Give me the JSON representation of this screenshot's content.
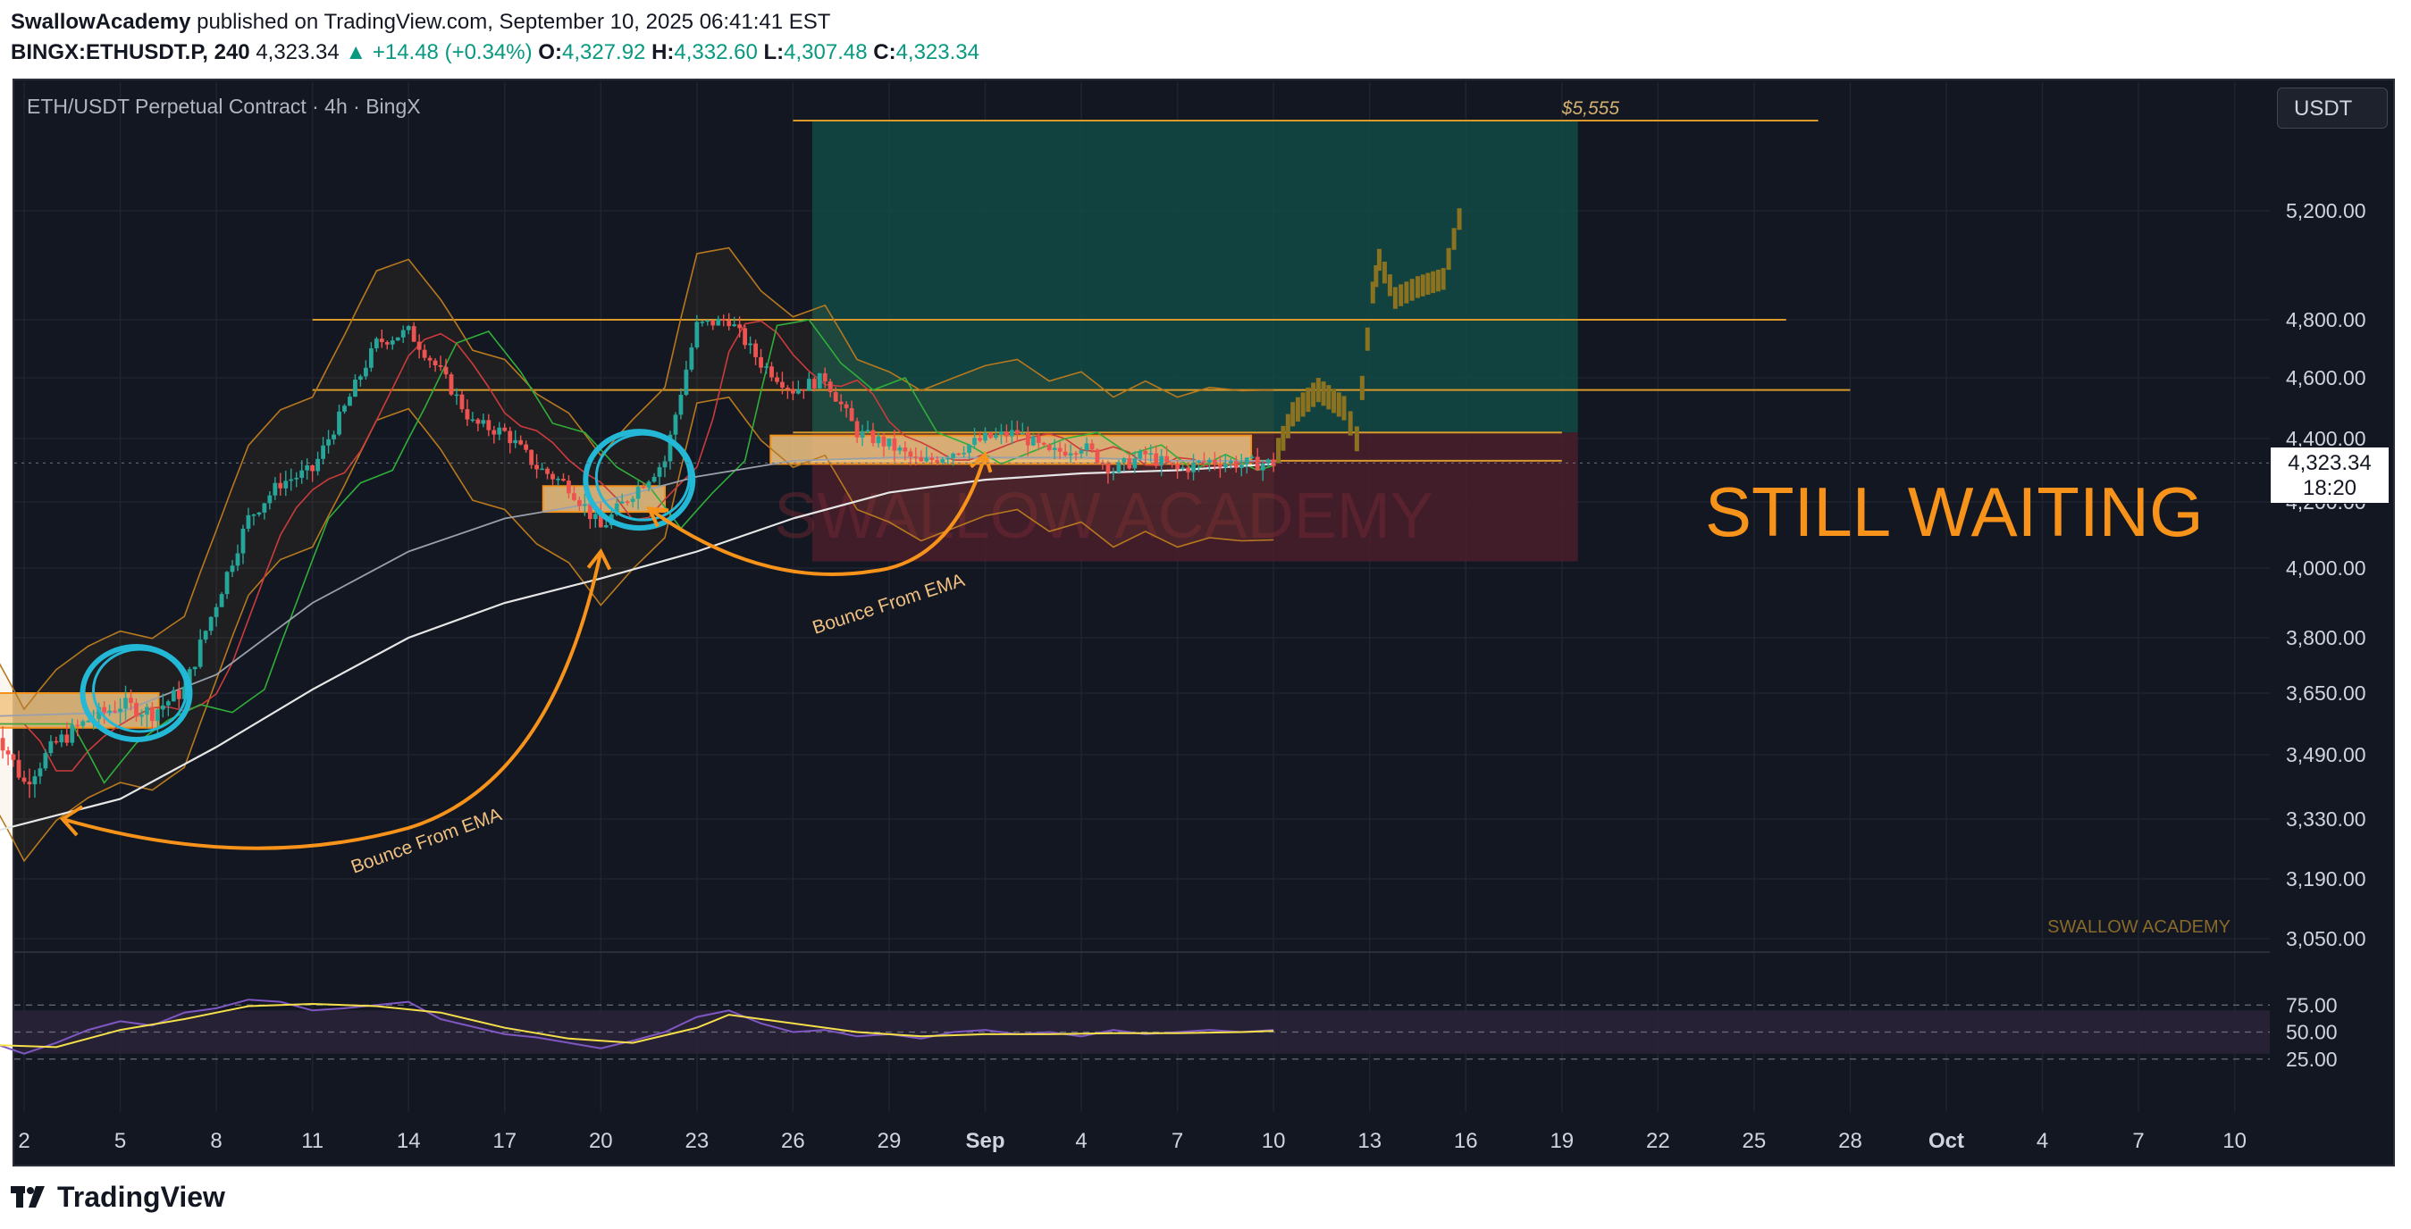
{
  "header": {
    "author": "SwallowAcademy",
    "published": "published on TradingView.com, September 10, 2025 06:41:41 EST",
    "symbol_line": "BINGX:ETHUSDT.P, 240",
    "last": "4,323.34",
    "change": "▲ +14.48 (+0.34%)",
    "o_label": "O:",
    "o": "4,327.92",
    "h_label": "H:",
    "h": "4,332.60",
    "l_label": "L:",
    "l": "4,307.48",
    "c_label": "C:",
    "c": "4,323.34"
  },
  "legend": "ETH/USDT Perpetual Contract · 4h · BingX",
  "currency_button": "USDT",
  "price_tag": {
    "price": "4,323.34",
    "countdown": "18:20"
  },
  "target_label": "$5,555",
  "annotations": {
    "big_text": "STILL WAITING",
    "watermark": "SWALLOW ACADEMY",
    "corner_watermark": "SWALLOW ACADEMY",
    "bounce_1": "Bounce From EMA",
    "bounce_2": "Bounce From EMA"
  },
  "footer": {
    "brand": "TradingView"
  },
  "colors": {
    "background": "#131722",
    "bull": "#26a69a",
    "bear": "#ef5350",
    "projection": "#8a7220",
    "annotation_orange": "#f7931a",
    "circle_cyan": "#22b8d6",
    "tp_zone": "#134a44",
    "sl_zone": "#4a1f2b",
    "rsi_band": "#2a2238"
  },
  "chart_data": {
    "type": "line",
    "title": "ETH/USDT Perpetual Contract · 4h · BingX",
    "price_ticks": [
      5200,
      4800,
      4600,
      4400,
      4200,
      4000,
      3800,
      3650,
      3490,
      3330,
      3190,
      3050
    ],
    "price_tick_labels": [
      "5,200.00",
      "4,800.00",
      "4,600.00",
      "4,400.00",
      "4,200.00",
      "4,000.00",
      "3,800.00",
      "3,650.00",
      "3,490.00",
      "3,330.00",
      "3,190.00",
      "3,050.00"
    ],
    "x_tick_labels": [
      "2",
      "5",
      "8",
      "11",
      "14",
      "17",
      "20",
      "23",
      "26",
      "29",
      "Sep",
      "4",
      "7",
      "10",
      "13",
      "16",
      "19",
      "22",
      "25",
      "28",
      "Oct",
      "4",
      "7",
      "10"
    ],
    "x_tick_days": [
      2,
      5,
      8,
      11,
      14,
      17,
      20,
      23,
      26,
      29,
      32,
      35,
      38,
      41,
      44,
      47,
      50,
      53,
      56,
      59,
      62,
      65,
      68,
      71
    ],
    "price_series": [
      [
        1,
        3570
      ],
      [
        2,
        3420
      ],
      [
        3,
        3520
      ],
      [
        4,
        3580
      ],
      [
        5,
        3620
      ],
      [
        6,
        3600
      ],
      [
        7,
        3660
      ],
      [
        8,
        3900
      ],
      [
        9,
        4150
      ],
      [
        10,
        4260
      ],
      [
        11,
        4300
      ],
      [
        12,
        4500
      ],
      [
        13,
        4720
      ],
      [
        14,
        4760
      ],
      [
        15,
        4620
      ],
      [
        16,
        4450
      ],
      [
        17,
        4420
      ],
      [
        18,
        4310
      ],
      [
        19,
        4250
      ],
      [
        20,
        4120
      ],
      [
        21,
        4230
      ],
      [
        22,
        4330
      ],
      [
        23,
        4780
      ],
      [
        24,
        4800
      ],
      [
        25,
        4650
      ],
      [
        26,
        4560
      ],
      [
        27,
        4600
      ],
      [
        28,
        4420
      ],
      [
        29,
        4380
      ],
      [
        30,
        4320
      ],
      [
        31,
        4360
      ],
      [
        32,
        4400
      ],
      [
        33,
        4420
      ],
      [
        34,
        4350
      ],
      [
        35,
        4380
      ],
      [
        36,
        4300
      ],
      [
        37,
        4350
      ],
      [
        38,
        4300
      ],
      [
        39,
        4330
      ],
      [
        40,
        4320
      ],
      [
        41,
        4323
      ]
    ],
    "projection": [
      [
        41,
        4323
      ],
      [
        41.6,
        4480
      ],
      [
        42.4,
        4560
      ],
      [
        43.2,
        4500
      ],
      [
        43.6,
        4400
      ],
      [
        44.1,
        4900
      ],
      [
        44.3,
        5020
      ],
      [
        44.8,
        4880
      ],
      [
        45.5,
        4920
      ],
      [
        46.3,
        4950
      ],
      [
        46.8,
        5170
      ]
    ],
    "horizontal_levels": [
      {
        "price": 5555,
        "from_day": 26,
        "to_day": 58
      },
      {
        "price": 4800,
        "from_day": 11,
        "to_day": 57
      },
      {
        "price": 4560,
        "from_day": 11,
        "to_day": 59
      },
      {
        "price": 4420,
        "from_day": 26,
        "to_day": 50
      },
      {
        "price": 4330,
        "from_day": 26,
        "to_day": 50
      }
    ],
    "zones": [
      {
        "kind": "take-profit",
        "price_from": 4420,
        "price_to": 5555,
        "from_day": 26.6,
        "to_day": 50.5
      },
      {
        "kind": "stop-loss",
        "price_from": 4020,
        "price_to": 4420,
        "from_day": 26.6,
        "to_day": 50.5
      }
    ],
    "demand_boxes": [
      {
        "price_from": 3560,
        "price_to": 3650,
        "from_day": 1,
        "to_day": 6.2
      },
      {
        "price_from": 4170,
        "price_to": 4250,
        "from_day": 18.2,
        "to_day": 22
      },
      {
        "price_from": 4320,
        "price_to": 4410,
        "from_day": 25.3,
        "to_day": 40.3
      }
    ],
    "ema_200": [
      [
        1,
        3300
      ],
      [
        5,
        3380
      ],
      [
        8,
        3510
      ],
      [
        11,
        3660
      ],
      [
        14,
        3800
      ],
      [
        17,
        3900
      ],
      [
        20,
        3970
      ],
      [
        23,
        4050
      ],
      [
        26,
        4150
      ],
      [
        29,
        4230
      ],
      [
        32,
        4270
      ],
      [
        35,
        4290
      ],
      [
        38,
        4300
      ],
      [
        41,
        4320
      ]
    ],
    "ema_100": [
      [
        1,
        3590
      ],
      [
        5,
        3600
      ],
      [
        8,
        3700
      ],
      [
        11,
        3900
      ],
      [
        14,
        4050
      ],
      [
        17,
        4150
      ],
      [
        20,
        4200
      ],
      [
        23,
        4280
      ],
      [
        26,
        4330
      ],
      [
        29,
        4340
      ],
      [
        32,
        4340
      ],
      [
        35,
        4340
      ],
      [
        38,
        4330
      ],
      [
        41,
        4330
      ]
    ],
    "rsi": {
      "ticks": [
        75,
        50,
        25
      ],
      "tick_labels": [
        "75.00",
        "50.00",
        "25.00"
      ],
      "band": [
        30,
        70
      ],
      "series": [
        [
          1,
          40
        ],
        [
          2,
          30
        ],
        [
          3,
          40
        ],
        [
          4,
          52
        ],
        [
          5,
          60
        ],
        [
          6,
          56
        ],
        [
          7,
          68
        ],
        [
          8,
          72
        ],
        [
          9,
          80
        ],
        [
          10,
          78
        ],
        [
          11,
          70
        ],
        [
          12,
          72
        ],
        [
          13,
          75
        ],
        [
          14,
          78
        ],
        [
          15,
          62
        ],
        [
          16,
          55
        ],
        [
          17,
          48
        ],
        [
          18,
          45
        ],
        [
          19,
          40
        ],
        [
          20,
          35
        ],
        [
          21,
          42
        ],
        [
          22,
          50
        ],
        [
          23,
          64
        ],
        [
          24,
          70
        ],
        [
          25,
          58
        ],
        [
          26,
          50
        ],
        [
          27,
          52
        ],
        [
          28,
          46
        ],
        [
          29,
          48
        ],
        [
          30,
          44
        ],
        [
          31,
          50
        ],
        [
          32,
          52
        ],
        [
          33,
          48
        ],
        [
          34,
          50
        ],
        [
          35,
          46
        ],
        [
          36,
          52
        ],
        [
          37,
          48
        ],
        [
          38,
          50
        ],
        [
          39,
          52
        ],
        [
          40,
          50
        ],
        [
          41,
          52
        ]
      ],
      "signal": [
        [
          1,
          38
        ],
        [
          3,
          36
        ],
        [
          5,
          52
        ],
        [
          7,
          62
        ],
        [
          9,
          74
        ],
        [
          11,
          76
        ],
        [
          13,
          74
        ],
        [
          15,
          68
        ],
        [
          17,
          54
        ],
        [
          19,
          44
        ],
        [
          21,
          40
        ],
        [
          23,
          54
        ],
        [
          24,
          66
        ],
        [
          26,
          58
        ],
        [
          28,
          50
        ],
        [
          30,
          46
        ],
        [
          32,
          48
        ],
        [
          34,
          48
        ],
        [
          36,
          49
        ],
        [
          38,
          49
        ],
        [
          40,
          50
        ],
        [
          41,
          51
        ]
      ]
    }
  }
}
